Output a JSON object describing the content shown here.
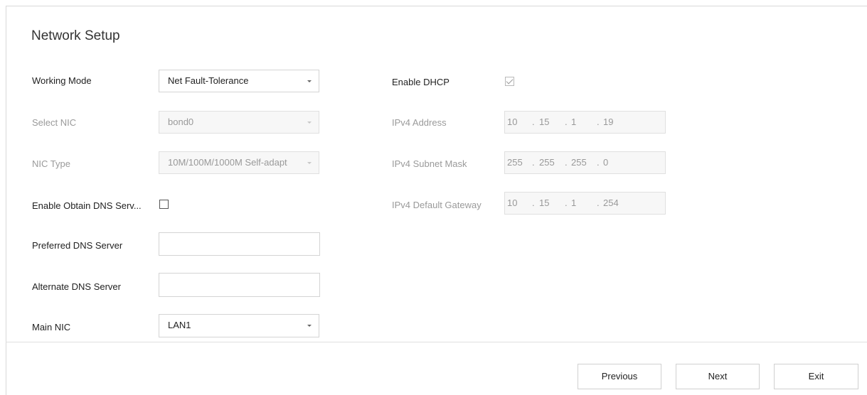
{
  "page": {
    "title": "Network Setup"
  },
  "left": {
    "working_mode": {
      "label": "Working Mode",
      "value": "Net Fault-Tolerance"
    },
    "select_nic": {
      "label": "Select NIC",
      "value": "bond0"
    },
    "nic_type": {
      "label": "NIC Type",
      "value": "10M/100M/1000M Self-adapt"
    },
    "enable_obtain_dns": {
      "label": "Enable Obtain DNS Serv...",
      "checked": false
    },
    "preferred_dns": {
      "label": "Preferred DNS Server",
      "value": ""
    },
    "alternate_dns": {
      "label": "Alternate DNS Server",
      "value": ""
    },
    "main_nic": {
      "label": "Main NIC",
      "value": "LAN1"
    }
  },
  "right": {
    "enable_dhcp": {
      "label": "Enable DHCP",
      "checked": true
    },
    "ipv4_address": {
      "label": "IPv4 Address",
      "octets": [
        "10",
        "15",
        "1",
        "19"
      ]
    },
    "ipv4_subnet_mask": {
      "label": "IPv4 Subnet Mask",
      "octets": [
        "255",
        "255",
        "255",
        "0"
      ]
    },
    "ipv4_default_gateway": {
      "label": "IPv4 Default Gateway",
      "octets": [
        "10",
        "15",
        "1",
        "254"
      ]
    }
  },
  "ip_separator": ".",
  "buttons": {
    "previous": "Previous",
    "next": "Next",
    "exit": "Exit"
  }
}
